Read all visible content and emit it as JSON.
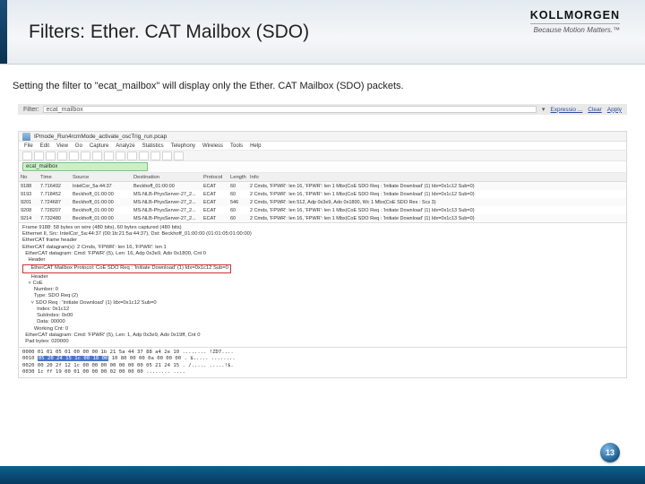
{
  "slide": {
    "title": "Filters: Ether. CAT Mailbox (SDO)",
    "caption": "Setting the filter to \"ecat_mailbox\" will display only the Ether. CAT Mailbox (SDO) packets.",
    "page_number": "13"
  },
  "brand": {
    "logo": "KOLLMORGEN",
    "tagline": "Because Motion Matters.™"
  },
  "greybar": {
    "label": "Filter:",
    "value": "ecat_mailbox",
    "expr": "Expressio ...",
    "clear": "Clear",
    "apply": "Apply"
  },
  "wireshark": {
    "file_title": "IPmode_Run4rcmMode_activate_oscTrig_run.pcap",
    "menu": [
      "File",
      "Edit",
      "View",
      "Go",
      "Capture",
      "Analyze",
      "Statistics",
      "Telephony",
      "Wireless",
      "Tools",
      "Help"
    ],
    "filter_value": "ecat_mailbox",
    "columns": [
      "No",
      "Time",
      "Source",
      "Destination",
      "Protocol",
      "Length",
      "Info"
    ],
    "packets": [
      {
        "no": "9188",
        "time": "7.716492",
        "src": "IntelCor_5a:44:37",
        "dst": "Beckhoff_01:00:00",
        "proto": "ECAT",
        "len": "60",
        "info": "2 Cmds, 'FPWR': len 16, 'FPWR': len 1  Mbx(CoE SDO Req : 'Initiate Download' (1) Idx=0x1c12 Sub=0)"
      },
      {
        "no": "9193",
        "time": "7.718452",
        "src": "Beckhoff_01:00:00",
        "dst": "MS-NLB-PhysServer-27_2...",
        "proto": "ECAT",
        "len": "60",
        "info": "2 Cmds, 'FPWR': len 16, 'FPWR': len 1  Mbx(CoE SDO Req : 'Initiate Download' (1) Idx=0x1c12 Sub=0)"
      },
      {
        "no": "9201",
        "time": "7.724687",
        "src": "Beckhoff_01:00:00",
        "dst": "MS-NLB-PhysServer-27_2...",
        "proto": "ECAT",
        "len": "546",
        "info": "2 Cmds, 'FPWR': len 512, Adp 0x3e9, Ado 0x1800, Wc 1 Mbx(CoE SDO Res : Scs 3)"
      },
      {
        "no": "9208",
        "time": "7.728207",
        "src": "Beckhoff_01:00:00",
        "dst": "MS-NLB-PhysServer-27_2...",
        "proto": "ECAT",
        "len": "60",
        "info": "2 Cmds, 'FPWR': len 16, 'FPWR': len 1  Mbx(CoE SDO Req : 'Initiate Download' (1) Idx=0x1c13 Sub=0)"
      },
      {
        "no": "9214",
        "time": "7.732480",
        "src": "Beckhoff_01:00:00",
        "dst": "MS-NLB-PhysServer-27_2...",
        "proto": "ECAT",
        "len": "60",
        "info": "2 Cmds, 'FPWR': len 16, 'FPWR': len 1  Mbx(CoE SDO Req : 'Initiate Download' (1) Idx=0x1c13 Sub=0)"
      }
    ],
    "detail": {
      "frame": "Frame 9188: 58 bytes on wire (480 bits), 60 bytes captured (480 bits)",
      "eth": "Ethernet II, Src: IntelCor_5a:44:37 (00:1b:21:5a:44:37), Dst: Beckhoff_01:00:00 (01:01:05:01:00:00)",
      "ecf": "EtherCAT frame header",
      "dg1": "EtherCAT datagram(s): 2 Cmds, 'FPWR': len 16, 'FPWR': len 1",
      "dg2": "  EtherCAT datagram: Cmd: 'FPWR' (5), Len: 16, Adp 0x3e9, Ado 0x1800, Cnt 0",
      "hdr": "    Header",
      "mbx": "    EtherCAT Mailbox Protocol: CoE SDO Req : 'Initiate Download' (1) Idx=0x1c12 Sub=0",
      "coe_hdr": "      Header",
      "coe": "    ˅ CoE",
      "num": "        Number: 0",
      "type": "        Type: SDO Req (2)",
      "sdoreq": "      ˅ SDO Req : 'Initiate Download' (1) Idx=0x1c12 Sub=0",
      "idx": "          Index: 0x1c12",
      "sub": "          SubIndex: 0x00",
      "data": "          Data: 00000",
      "wc": "        Working Cnt: 0",
      "dg3": "  EtherCAT datagram: Cmd: 'FPWR' (5), Len: 1, Adp 0x3e9, Ado 0x19ff, Cnt 0",
      "pad": "  Pad bytes: 020000"
    },
    "hex": {
      "r0": "0000  01 01 05 01 00 00 00 1b  21 5a 44 37 88 a4 2e 10   ........ !ZD7....",
      "r1": "0010  05 20 24 15 1c 00 18 00  10 80 00 00 0a 00 00 00   . $..... ........",
      "r1_sel": "05 20 24 15 1c 00 18 00",
      "r2": "0020  00 20 2f 12 1c 00 00 00  00 00 00 00 05 21 24 15   . /..... .....!$.",
      "r3": "0030  1c ff 19 00 01 00 00 00  02 00 00 00              ........  ...."
    }
  }
}
